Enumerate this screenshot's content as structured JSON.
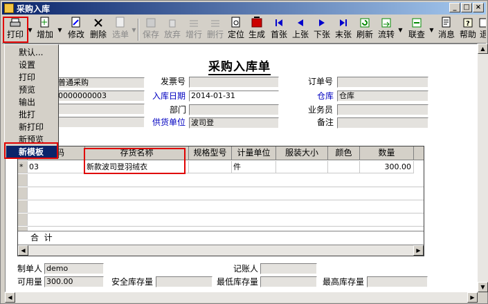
{
  "window": {
    "title": "采购入库"
  },
  "toolbar": {
    "print": "打印",
    "add": "增加",
    "edit": "修改",
    "delete": "删除",
    "select": "选单",
    "save": "保存",
    "abandon": "放弃",
    "add_row": "增行",
    "del_row": "删行",
    "locate": "定位",
    "generate": "生成",
    "first": "首张",
    "prev": "上张",
    "next": "下张",
    "last": "末张",
    "refresh": "刷新",
    "flow": "流转",
    "query": "联查",
    "message": "消息",
    "help": "帮助",
    "exit": "退"
  },
  "print_menu": {
    "items": [
      "默认...",
      "设置",
      "打印",
      "预览",
      "输出",
      "批打",
      "新打印",
      "新预览",
      "新模板"
    ],
    "selected": "新模板"
  },
  "form": {
    "title": "采购入库单",
    "type_value": "普通采购",
    "number_value": "0000000003",
    "invoice_no_label": "发票号",
    "inbound_date_label": "入库日期",
    "inbound_date_value": "2014-01-31",
    "department_label": "部门",
    "supplier_label": "供货单位",
    "supplier_value": "波司登",
    "order_no_label": "订单号",
    "warehouse_label": "仓库",
    "warehouse_value": "仓库",
    "salesperson_label": "业务员",
    "remarks_label": "备注"
  },
  "grid": {
    "columns": [
      "编码",
      "存货名称",
      "规格型号",
      "计量单位",
      "服装大小",
      "颜色",
      "数量"
    ],
    "rows": [
      {
        "marker": "*",
        "code": "03",
        "name": "新款波司登羽绒衣",
        "spec": "",
        "unit": "件",
        "size": "",
        "color": "",
        "qty": "300.00"
      }
    ],
    "total_label": "合  计"
  },
  "footer": {
    "maker_label": "制单人",
    "maker_value": "demo",
    "bookkeeper_label": "记账人",
    "available_label": "可用量",
    "available_value": "300.00",
    "safety_stock_label": "安全库存量",
    "min_stock_label": "最低库存量",
    "max_stock_label": "最高库存量"
  },
  "colors": {
    "highlight": "#e00000",
    "link_label": "#0000c0",
    "menu_selected": "#0a246a"
  }
}
